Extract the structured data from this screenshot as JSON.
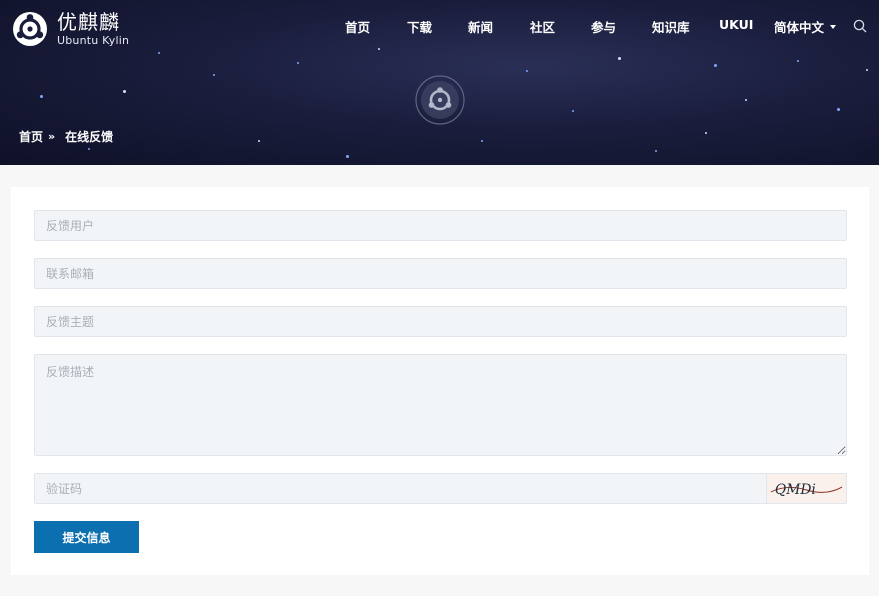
{
  "brand": {
    "name_cn": "优麒麟",
    "name_en": "Ubuntu Kylin"
  },
  "nav": {
    "items": [
      "首页",
      "下载",
      "新闻",
      "社区",
      "参与",
      "知识库",
      "UKUI"
    ],
    "language": "简体中文",
    "search_icon": "search-icon"
  },
  "breadcrumb": {
    "home": "首页",
    "separator": "»",
    "current": "在线反馈"
  },
  "form": {
    "user_placeholder": "反馈用户",
    "email_placeholder": "联系邮箱",
    "subject_placeholder": "反馈主题",
    "description_placeholder": "反馈描述",
    "captcha_placeholder": "验证码",
    "captcha_text": "QMDi",
    "submit_label": "提交信息"
  },
  "colors": {
    "accent": "#0c6fb0",
    "field_bg": "#f2f5f8",
    "header_bg": "#1a1d3c"
  }
}
